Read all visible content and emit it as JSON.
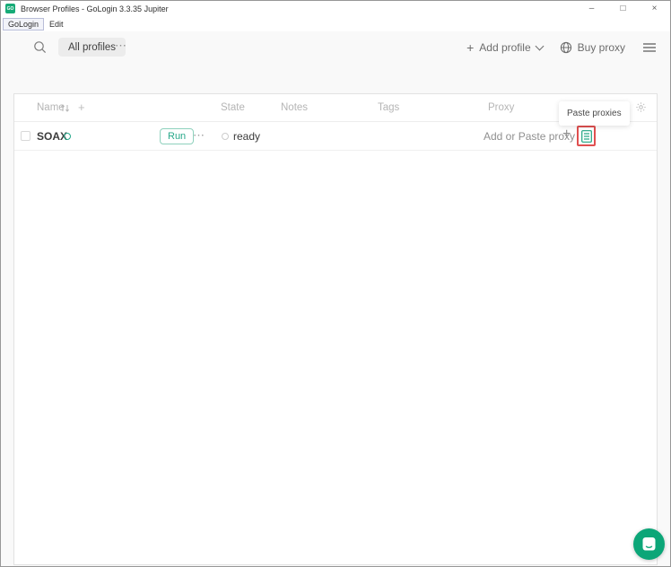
{
  "window": {
    "title": "Browser Profiles - GoLogin 3.3.35 Jupiter",
    "app_icon_text": "GO"
  },
  "menubar": {
    "items": [
      {
        "label": "GoLogin"
      },
      {
        "label": "Edit"
      }
    ]
  },
  "toolbar": {
    "all_profiles_label": "All profiles",
    "add_profile_label": "Add profile",
    "buy_proxy_label": "Buy proxy"
  },
  "table": {
    "headers": {
      "name": "Name",
      "state": "State",
      "notes": "Notes",
      "tags": "Tags",
      "proxy": "Proxy"
    },
    "rows": [
      {
        "name": "SOAX",
        "run_label": "Run",
        "state": "ready",
        "proxy_placeholder": "Add or Paste proxy"
      }
    ]
  },
  "tooltip": {
    "text": "Paste proxies"
  },
  "icons": {
    "minimize": "–",
    "maximize": "□",
    "close": "×",
    "more": "⋯",
    "plus": "+"
  },
  "colors": {
    "brand_green": "#0ca678",
    "run_green": "#28a88a",
    "highlight_red": "#e05050",
    "header_gray": "#b5b5b5"
  }
}
